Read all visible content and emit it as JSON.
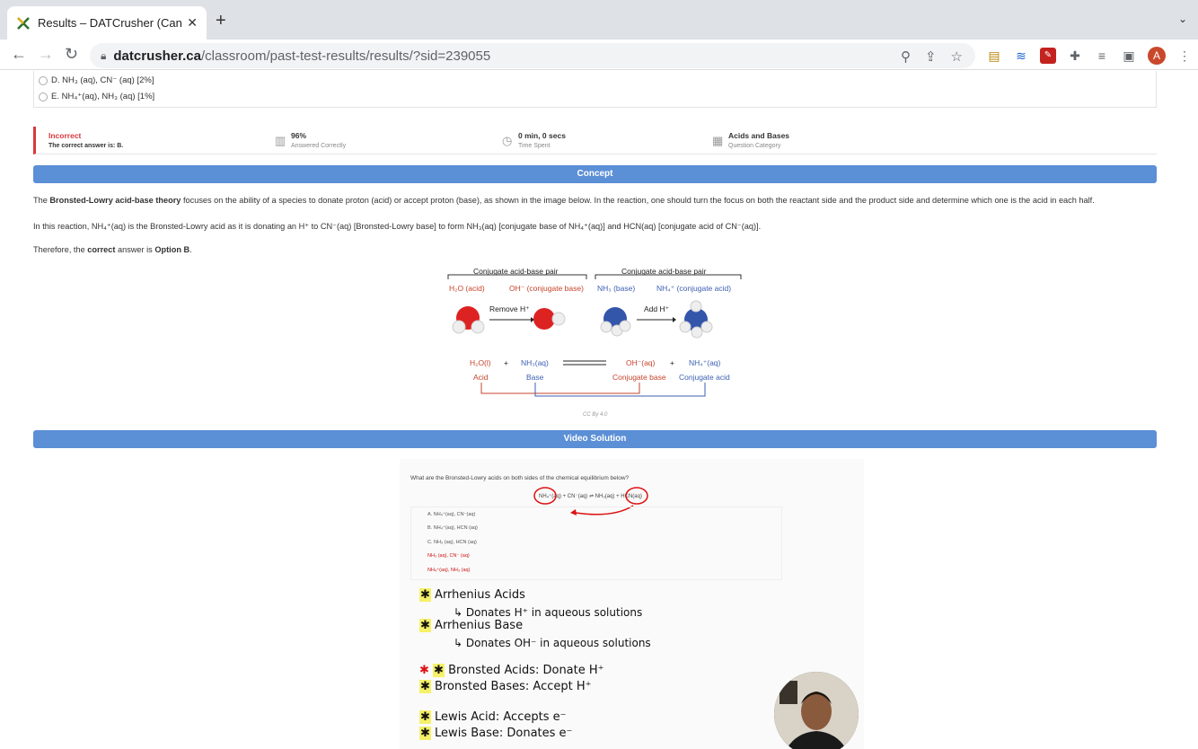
{
  "browser": {
    "tab_title": "Results – DATCrusher (Canadia",
    "url_host": "datcrusher.ca",
    "url_path": "/classroom/past-test-results/results/?sid=239055",
    "avatar_letter": "A"
  },
  "options": [
    {
      "label": "D. NH₃ (aq), CN⁻ (aq) [2%]"
    },
    {
      "label": "E. NH₄⁺(aq), NH₃ (aq) [1%]"
    }
  ],
  "result": {
    "status": "Incorrect",
    "correct_answer": "The correct answer is: B.",
    "percent": "96%",
    "percent_label": "Answered Correctly",
    "time": "0 min, 0 secs",
    "time_label": "Time Spent",
    "category": "Acids and Bases",
    "category_label": "Question Category"
  },
  "concept": {
    "header": "Concept",
    "p1_bold": "Bronsted-Lowry acid-base theory",
    "p1_pre": "The ",
    "p1_rest": " focuses on the ability of a species to donate proton (acid) or accept proton (base), as shown in the image below. In the reaction, one should turn the focus on both the reactant side and the product side and determine which one is the acid in each half.",
    "p2": "In this reaction, NH₄⁺(aq) is the Bronsted-Lowry acid as it is donating an H⁺ to CN⁻(aq) [Bronsted-Lowry base] to form NH₃(aq) [conjugate base of NH₄⁺(aq)] and HCN(aq) [conjugate acid of CN⁻(aq)].",
    "p3_pre": "Therefore, the ",
    "p3_b1": "correct",
    "p3_mid": " answer is ",
    "p3_b2": "Option B",
    "p3_end": "."
  },
  "diagram": {
    "pair_left": "Conjugate acid-base pair",
    "pair_right": "Conjugate acid-base pair",
    "h2o_acid": "H₂O (acid)",
    "oh_base": "OH⁻ (conjugate base)",
    "nh3_base": "NH₃ (base)",
    "nh4_acid": "NH₄⁺ (conjugate acid)",
    "remove": "Remove H⁺",
    "add": "Add H⁺",
    "eq_h2o": "H₂O(l)",
    "eq_plus1": "+",
    "eq_nh3": "NH₃(aq)",
    "eq_oh": "OH⁻(aq)",
    "eq_plus2": "+",
    "eq_nh4": "NH₄⁺(aq)",
    "acid": "Acid",
    "base": "Base",
    "conj_base": "Conjugate base",
    "conj_acid": "Conjugate acid",
    "license": "CC By 4.0",
    "colors": {
      "red": "#c7442c",
      "blue": "#3d5fb3"
    }
  },
  "video": {
    "header": "Video Solution",
    "question": "What are the Bronsted-Lowry acids on both sides of the chemical equilibrium below?",
    "equation": "NH₄⁺(aq) + CN⁻(aq) ⇌ NH₃(aq) + HCN(aq)",
    "options": [
      "A. NH₄⁺(aq), CN⁻(aq)",
      "B. NH₄⁺(aq), HCN (aq)",
      "C. NH₃ (aq), HCN (aq)",
      "NH₃ (aq), CN⁻ (aq)",
      "NH₄⁺(aq), NH₃ (aq)"
    ],
    "notes": [
      "Arrhenius Acids",
      "↳ Donates H⁺ in aqueous solutions",
      "Arrhenius Base",
      "↳ Donates OH⁻ in aqueous solutions",
      "Bronsted Acids: Donate H⁺",
      "Bronsted Bases: Accept H⁺",
      "Lewis Acid: Accepts e⁻",
      "Lewis Base: Donates e⁻"
    ]
  }
}
